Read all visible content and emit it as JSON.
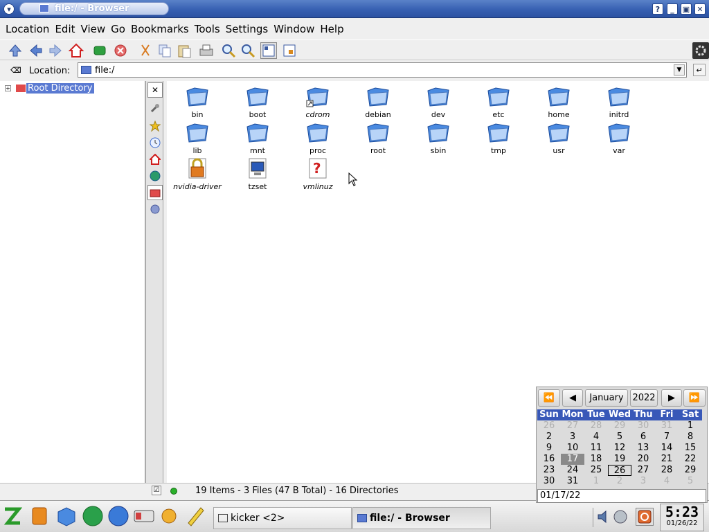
{
  "window": {
    "title": "file:/ - Browser"
  },
  "menubar": {
    "items": [
      "Location",
      "Edit",
      "View",
      "Go",
      "Bookmarks",
      "Tools",
      "Settings",
      "Window",
      "Help"
    ]
  },
  "toolbar": {
    "icons": [
      "up-icon",
      "back-icon",
      "forward-icon",
      "home-icon",
      "reload-icon",
      "stop-icon",
      "cut-icon",
      "copy-icon",
      "paste-icon",
      "print-icon",
      "zoom-in-icon",
      "zoom-out-icon",
      "icon-view-icon",
      "tree-view-icon"
    ]
  },
  "locationbar": {
    "label": "Location:",
    "value": "file:/"
  },
  "sidebar": {
    "tree_root": "Root Directory"
  },
  "files": [
    {
      "name": "bin",
      "type": "folder"
    },
    {
      "name": "boot",
      "type": "folder"
    },
    {
      "name": "cdrom",
      "type": "link-folder"
    },
    {
      "name": "debian",
      "type": "folder"
    },
    {
      "name": "dev",
      "type": "folder"
    },
    {
      "name": "etc",
      "type": "folder"
    },
    {
      "name": "home",
      "type": "folder"
    },
    {
      "name": "initrd",
      "type": "folder"
    },
    {
      "name": "lib",
      "type": "folder"
    },
    {
      "name": "mnt",
      "type": "folder"
    },
    {
      "name": "proc",
      "type": "folder"
    },
    {
      "name": "root",
      "type": "folder"
    },
    {
      "name": "sbin",
      "type": "folder"
    },
    {
      "name": "tmp",
      "type": "folder"
    },
    {
      "name": "usr",
      "type": "folder"
    },
    {
      "name": "var",
      "type": "folder"
    },
    {
      "name": "nvidia-driver",
      "type": "locked-file"
    },
    {
      "name": "tzset",
      "type": "executable"
    },
    {
      "name": "vmlinuz",
      "type": "unknown-file"
    }
  ],
  "status": {
    "text": "19 Items - 3 Files (47 B Total) - 16 Directories"
  },
  "taskbar": {
    "tasks": [
      {
        "label": "kicker <2>"
      },
      {
        "label": "file:/ - Browser"
      }
    ],
    "clock_time": "5:23",
    "clock_date": "01/26/22"
  },
  "calendar": {
    "month": "January",
    "year": "2022",
    "weekdays": [
      "Sun",
      "Mon",
      "Tue",
      "Wed",
      "Thu",
      "Fri",
      "Sat"
    ],
    "weeks": [
      [
        "26",
        "27",
        "28",
        "29",
        "30",
        "31",
        "1"
      ],
      [
        "2",
        "3",
        "4",
        "5",
        "6",
        "7",
        "8"
      ],
      [
        "9",
        "10",
        "11",
        "12",
        "13",
        "14",
        "15"
      ],
      [
        "16",
        "17",
        "18",
        "19",
        "20",
        "21",
        "22"
      ],
      [
        "23",
        "24",
        "25",
        "26",
        "27",
        "28",
        "29"
      ],
      [
        "30",
        "31",
        "1",
        "2",
        "3",
        "4",
        "5"
      ]
    ],
    "selected_date": "01/17/22"
  },
  "colors": {
    "titlebar": "#3760b2",
    "selection": "#5a7ad2",
    "calendar_header": "#3858b8"
  }
}
